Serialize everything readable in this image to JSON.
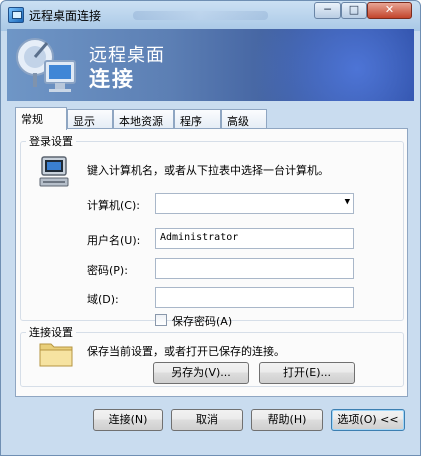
{
  "window": {
    "title": "远程桌面连接"
  },
  "banner": {
    "line1": "远程桌面",
    "line2": "连接"
  },
  "titlebar": {
    "min_glyph": "─",
    "max_glyph": "□",
    "close_glyph": "✕"
  },
  "tabs": [
    {
      "label": "常规",
      "active": true
    },
    {
      "label": "显示"
    },
    {
      "label": "本地资源"
    },
    {
      "label": "程序"
    },
    {
      "label": "高级"
    }
  ],
  "logon": {
    "title": "登录设置",
    "instruction": "键入计算机名，或者从下拉表中选择一台计算机。",
    "computer_label": "计算机(C):",
    "computer_value": "",
    "username_label": "用户名(U):",
    "username_value": "Administrator",
    "password_label": "密码(P):",
    "password_value": "",
    "domain_label": "域(D):",
    "domain_value": "",
    "save_password_label": "保存密码(A)",
    "save_password_checked": false
  },
  "connection": {
    "title": "连接设置",
    "description": "保存当前设置，或者打开已保存的连接。",
    "save_as_label": "另存为(V)...",
    "open_label": "打开(E)..."
  },
  "footer": {
    "connect_label": "连接(N)",
    "cancel_label": "取消",
    "help_label": "帮助(H)",
    "options_label": "选项(O) <<"
  },
  "icons": {
    "app": "remote-desktop-icon",
    "banner": "remote-desktop-satellite-icon",
    "computer": "computer-icon",
    "folder": "folder-icon"
  }
}
